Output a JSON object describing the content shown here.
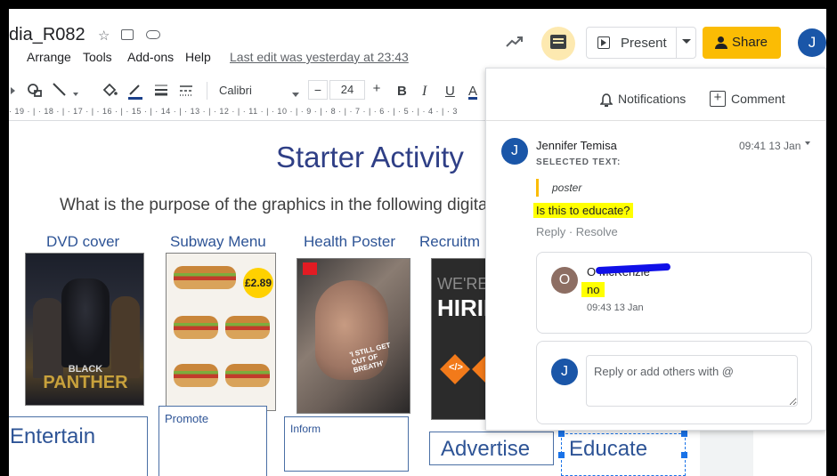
{
  "header": {
    "doc_title": "dia_R082",
    "menu": [
      "Arrange",
      "Tools",
      "Add-ons",
      "Help"
    ],
    "last_edit": "Last edit was yesterday at 23:43",
    "present_label": "Present",
    "share_label": "Share",
    "user_initial": "J"
  },
  "toolbar": {
    "font": "Calibri",
    "font_size": "24",
    "minus": "−",
    "plus": "+",
    "bold": "B",
    "italic": "I",
    "underline": "U",
    "text_color": "A",
    "ruler": "· 19 · | · 18 · | · 17 · | · 16 · | · 15 · | · 14 · | · 13 · | · 12 · | · 11 · | · 10 · | · 9 · | · 8 · | · 7 · | · 6 · | · 5 · | · 4 · | · 3"
  },
  "slide": {
    "title": "Starter Activity",
    "question": "What is the purpose of the graphics in the following digita",
    "categories": [
      "DVD cover",
      "Subway Menu",
      "Health Poster",
      "Recruitm"
    ],
    "dvd_text": [
      "BLACK",
      "PANTHER"
    ],
    "subway_price": "£2.89",
    "health_caption": "'I STILL GET OUT OF BREATH'",
    "recruit_text": [
      "WE'RE",
      "HIRIN"
    ],
    "answers": {
      "entertain": "Entertain",
      "promote": "Promote",
      "inform": "Inform",
      "advertise": "Advertise",
      "educate": "Educate"
    }
  },
  "comments_panel": {
    "notifications_label": "Notifications",
    "comment_label": "Comment",
    "thread": {
      "author_initial": "J",
      "author": "Jennifer Temisa",
      "time": "09:41 13 Jan",
      "selected_label": "SELECTED TEXT:",
      "selected_text": "poster",
      "body": "Is this to educate?",
      "actions": "Reply · Resolve"
    },
    "reply": {
      "initial": "O",
      "name": "O       McKenzie",
      "body": "no",
      "time": "09:43 13 Jan"
    },
    "input": {
      "initial": "J",
      "placeholder": "Reply or add others with @"
    }
  },
  "colors": {
    "share_yellow": "#fbbc04",
    "avatar_blue": "#1a56a8",
    "highlight": "#ffff00",
    "slide_blue": "#2e5496"
  }
}
